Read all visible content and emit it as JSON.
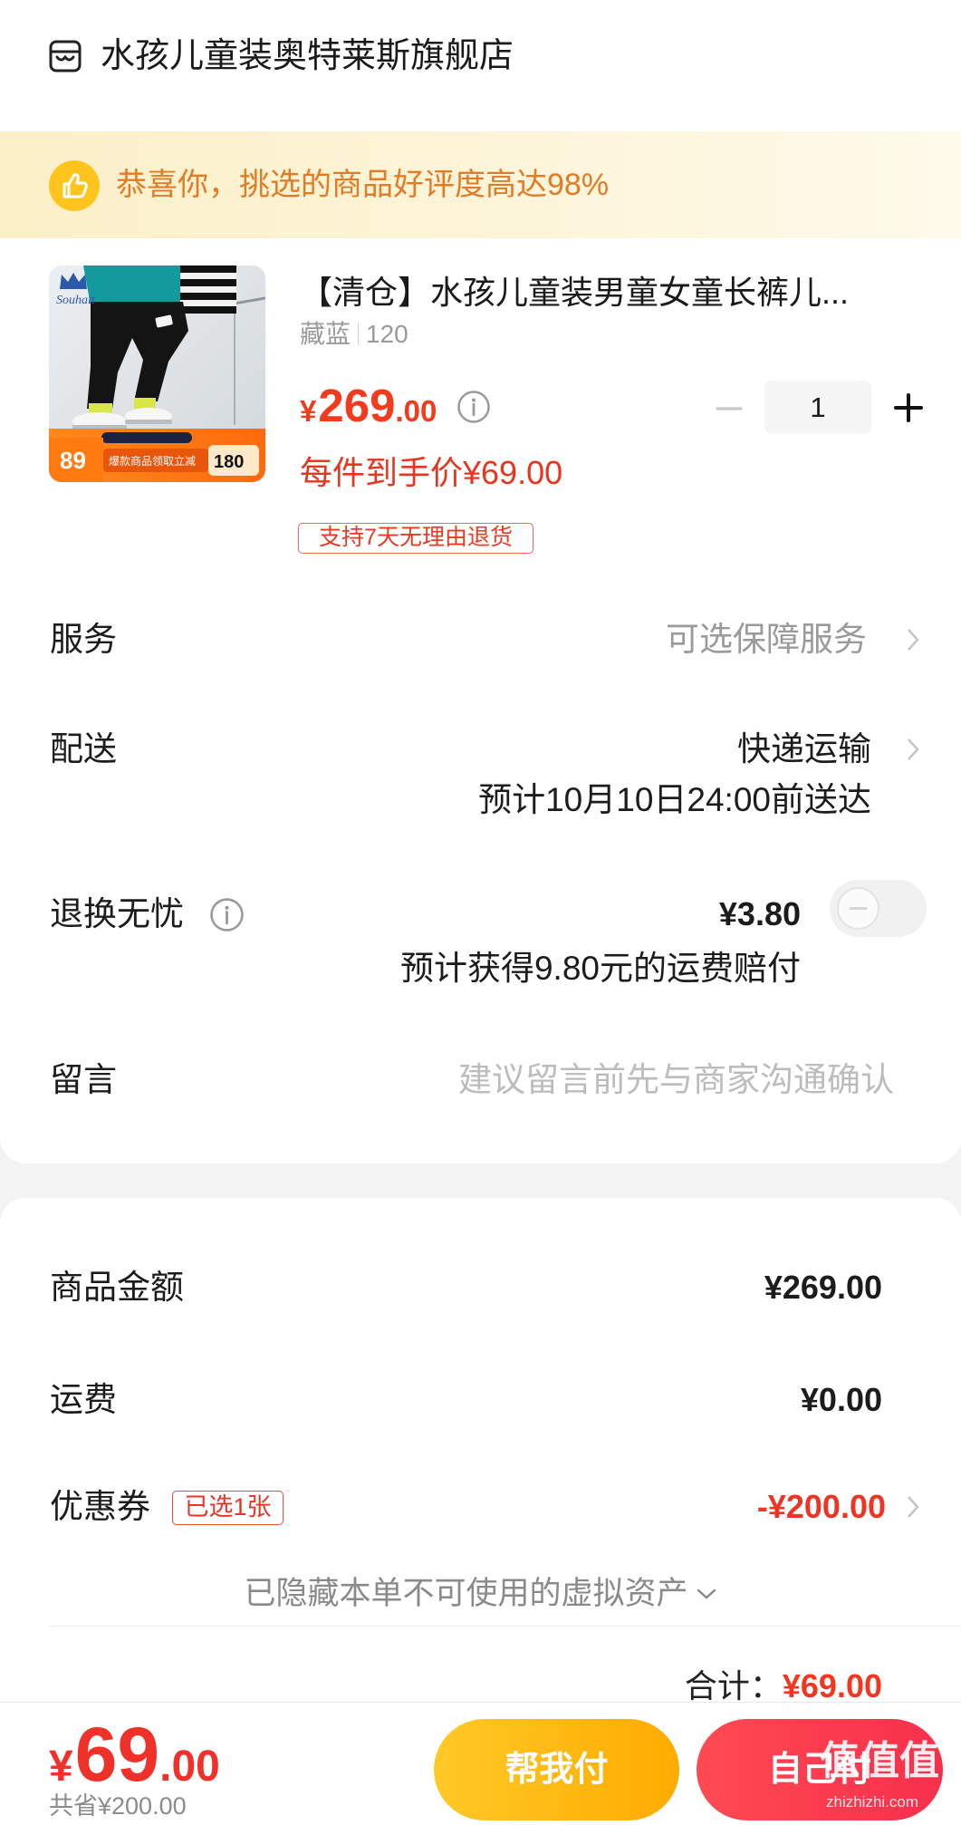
{
  "shop": {
    "name": "水孩儿童装奥特莱斯旗舰店",
    "icon": "store-icon"
  },
  "banner": {
    "icon": "thumbs-up-icon",
    "text": "恭喜你，挑选的商品好评度高达98%"
  },
  "product": {
    "title": "【清仓】水孩儿童装男童女童长裤儿...",
    "spec_color": "藏蓝",
    "spec_size": "120",
    "price": {
      "symbol": "¥",
      "integer": "269",
      "decimal": ".00"
    },
    "quantity": "1",
    "final_price": "每件到手价¥69.00",
    "return_tag": "支持7天无理由退货",
    "image": {
      "brand": "Souhait",
      "badge_price": "89",
      "promo": "爆款商品领取立减",
      "promo_amount": "180"
    }
  },
  "options": {
    "service": {
      "label": "服务",
      "value": "可选保障服务"
    },
    "delivery": {
      "label": "配送",
      "method": "快递运输",
      "eta": "预计10月10日24:00前送达"
    },
    "return_insurance": {
      "label": "退换无忧",
      "price": "¥3.80",
      "note": "预计获得9.80元的运费赔付",
      "enabled": false
    },
    "message": {
      "label": "留言",
      "placeholder": "建议留言前先与商家沟通确认"
    }
  },
  "summary": {
    "goods_amount": {
      "label": "商品金额",
      "value": "¥269.00"
    },
    "shipping": {
      "label": "运费",
      "value": "¥0.00"
    },
    "coupon": {
      "label": "优惠券",
      "tag": "已选1张",
      "value": "-¥200.00"
    },
    "hidden_assets": "已隐藏本单不可使用的虚拟资产",
    "total_label": "合计：",
    "total_value": "¥69.00"
  },
  "footer": {
    "price": {
      "symbol": "¥",
      "integer": "69",
      "decimal": ".00"
    },
    "saved": "共省¥200.00",
    "pay_for_me": "帮我付",
    "pay_self": "自己付"
  },
  "watermark": {
    "logo": "值值值",
    "url": "zhizhizhi.com"
  },
  "colors": {
    "accent_red": "#f23a1d",
    "banner_bg": "#fdf4d6",
    "banner_text": "#e37b25",
    "pay_for_me_button": "#ffb80e",
    "pay_self_button": "#f8344a"
  }
}
